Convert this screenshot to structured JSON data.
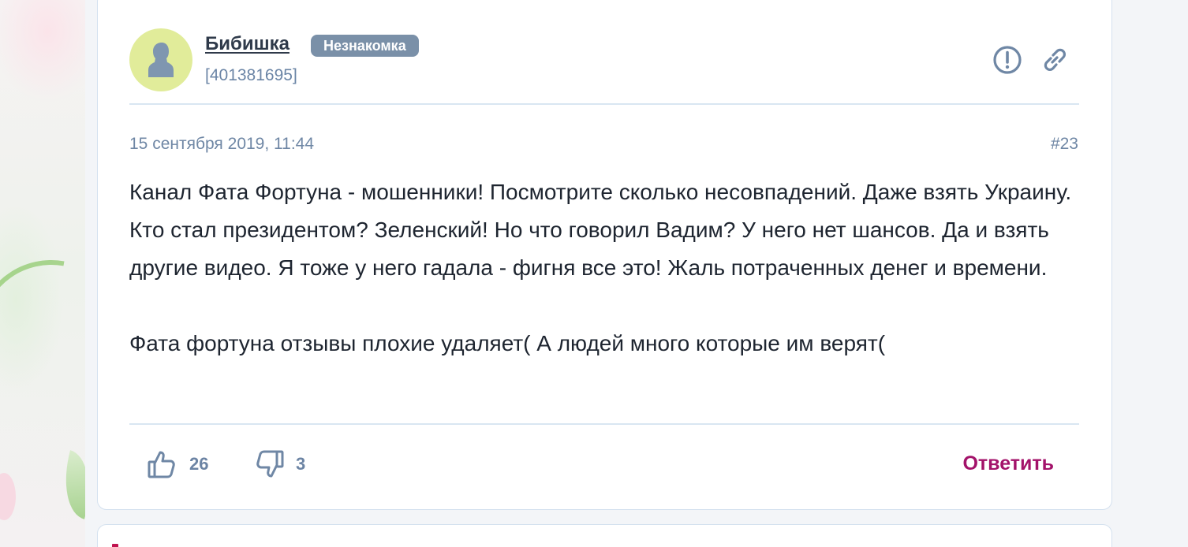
{
  "comment": {
    "author": "Бибишка",
    "badge": "Незнакомка",
    "user_id": "[401381695]",
    "date": "15 сентября 2019, 11:44",
    "number": "#23",
    "body": [
      "Канал Фата Фортуна - мошенники! Посмотрите сколько несовпадений. Даже взять Украину. Кто стал президентом? Зеленский! Но что говорил Вадим? У него нет шансов. Да и взять другие видео. Я тоже у него гадала - фигня все это! Жаль потраченных денег и времени.",
      "Фата фортуна отзывы плохие удаляет( А людей много которые им верят("
    ],
    "likes": "26",
    "dislikes": "3",
    "reply_label": "Ответить"
  },
  "icons": {
    "avatar": "user-silhouette-icon",
    "report": "exclamation-circle-icon",
    "link": "link-chain-icon",
    "like": "thumbs-up-icon",
    "dislike": "thumbs-down-icon"
  },
  "colors": {
    "accent": "#a3126a",
    "muted": "#6f87a5",
    "badge_bg": "#7a90a8",
    "avatar_bg": "#e1ec9a"
  }
}
